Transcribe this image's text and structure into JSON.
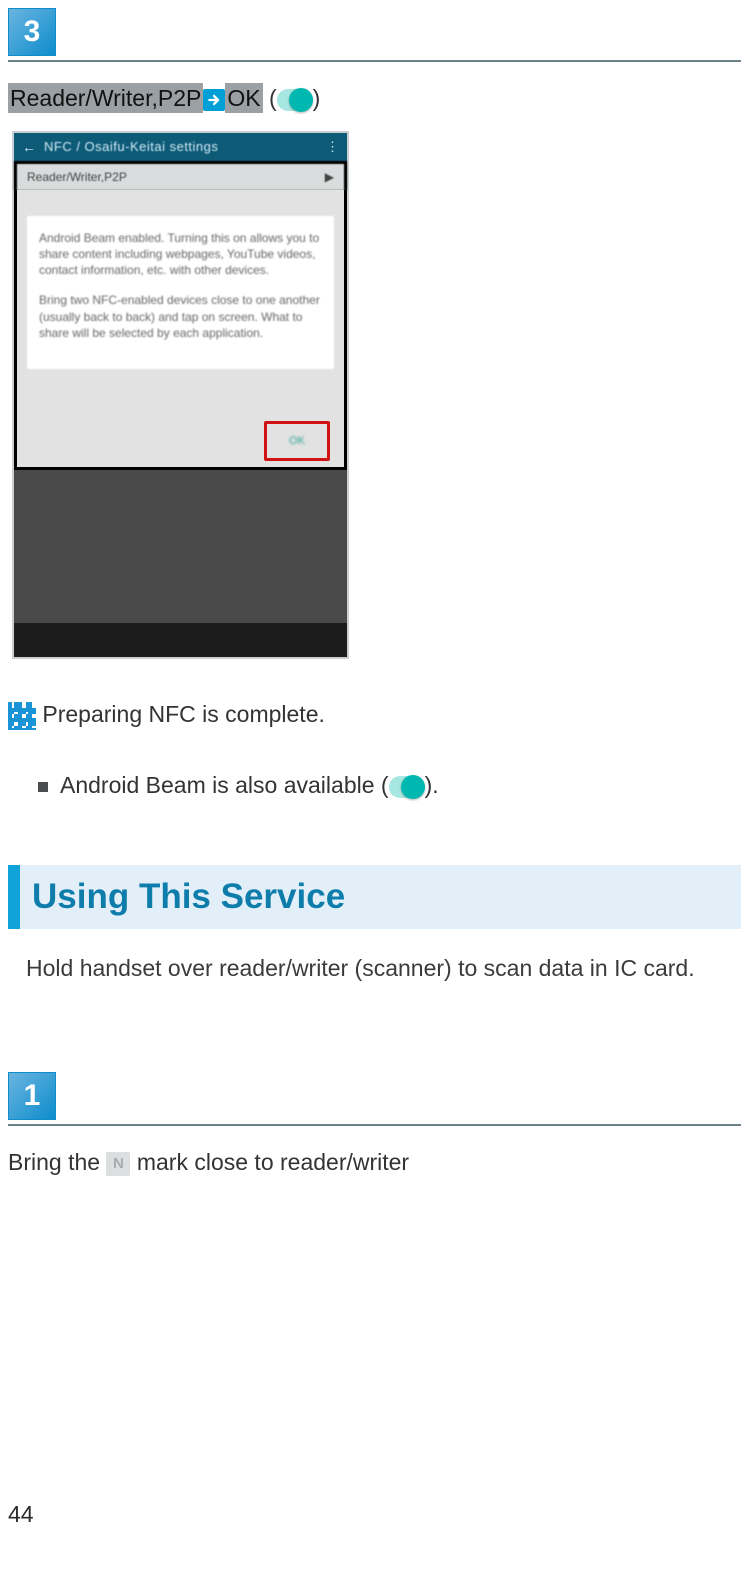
{
  "step3": {
    "number": "3",
    "text_reader": "Reader/Writer,P2P",
    "text_ok": "OK",
    "paren_open": " (",
    "paren_close": ")"
  },
  "phone": {
    "header_title": "NFC / Osaifu-Keitai settings",
    "subbar_left": "Reader/Writer,P2P",
    "dialog_p1": "Android Beam enabled. Turning this on allows you to share content including webpages, YouTube videos, contact information, etc. with other devices.",
    "dialog_p2": "Bring two NFC-enabled devices close to one another (usually back to back) and tap on screen. What to share will be selected by each application.",
    "dialog_btn": "OK"
  },
  "result": {
    "text": " Preparing NFC is complete."
  },
  "bullet": {
    "text_before": "Android Beam is also available (",
    "text_after": ")."
  },
  "section": {
    "title": "Using This Service",
    "desc": "Hold handset over reader/writer (scanner) to scan data in IC card."
  },
  "step1": {
    "number": "1",
    "text_before": "Bring the ",
    "nfc_mark": "N",
    "text_after": " mark close to reader/writer"
  },
  "page_number": "44"
}
